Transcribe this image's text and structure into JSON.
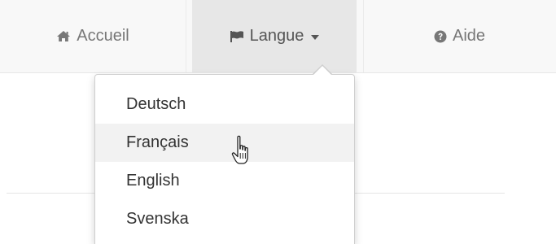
{
  "navbar": {
    "items": [
      {
        "label": "Accueil",
        "icon": "home-icon"
      },
      {
        "label": "Langue",
        "icon": "flag-icon",
        "has_caret": true
      },
      {
        "label": "Aide",
        "icon": "question-circle-icon"
      }
    ]
  },
  "language_menu": {
    "options": [
      "Deutsch",
      "Français",
      "English",
      "Svenska"
    ],
    "hovered": "Français"
  },
  "colors": {
    "navbar_bg": "#f8f8f8",
    "active_bg": "#e7e7e7",
    "nav_text": "#777777",
    "menu_text": "#333333",
    "hover_bg": "#f2f2f2"
  }
}
